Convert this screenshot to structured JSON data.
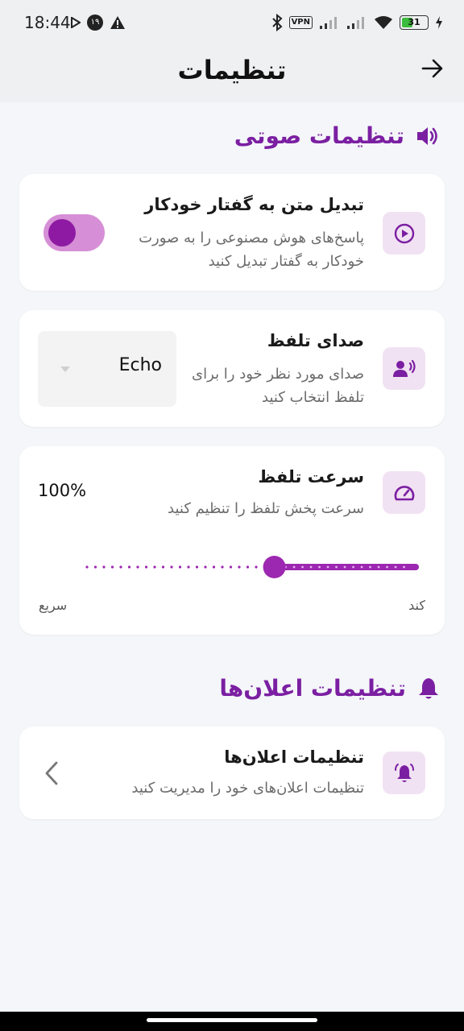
{
  "status_bar": {
    "time": "18:44",
    "left_icons": [
      "play-store-icon",
      "notification-badge-icon",
      "warning-icon"
    ],
    "badge_number": "۱۹",
    "vpn_label": "VPN",
    "battery_level": "31",
    "right_icons": [
      "bluetooth-icon",
      "vpn-icon",
      "signal-icon",
      "signal-icon",
      "wifi-icon",
      "battery-icon",
      "charging-icon"
    ]
  },
  "app_bar": {
    "title": "تنظیمات",
    "back_icon": "arrow-right-icon"
  },
  "sound_section": {
    "title": "تنظیمات صوتی",
    "icon": "speaker-icon"
  },
  "tts_card": {
    "title": "تبدیل متن به گفتار خودکار",
    "description": "پاسخ‌های هوش مصنوعی را به صورت خودکار به گفتار تبدیل کنید",
    "icon": "play-circle-icon",
    "enabled": true
  },
  "voice_card": {
    "title": "صدای تلفظ",
    "description": "صدای مورد نظر خود را برای تلفظ انتخاب کنید",
    "icon": "voice-person-icon",
    "selected_voice": "Echo"
  },
  "speed_card": {
    "title": "سرعت تلفظ",
    "description": "سرعت پخش تلفظ را تنظیم کنید",
    "icon": "speedometer-icon",
    "value_label": "100%",
    "slider_fraction": 0.43,
    "slow_label": "کند",
    "fast_label": "سریع"
  },
  "notification_section": {
    "title": "تنظیمات اعلان‌ها",
    "icon": "bell-icon"
  },
  "notification_card": {
    "title": "تنظیمات اعلان‌ها",
    "description": "تنظیمات اعلان‌های خود را مدیریت کنید",
    "icon": "bell-ringing-icon",
    "chevron_icon": "chevron-left-icon"
  },
  "colors": {
    "accent": "#7b1fa2",
    "icon_bg": "#f1e2f3",
    "toggle_track": "#d68fd6",
    "toggle_knob": "#8e1aa3"
  }
}
